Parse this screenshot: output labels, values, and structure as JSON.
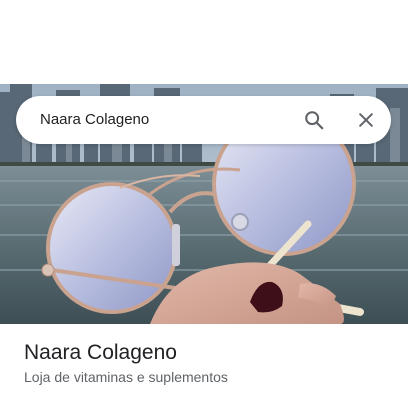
{
  "search": {
    "query": "Naara Colageno",
    "search_icon": "search-icon",
    "close_icon": "close-icon"
  },
  "place": {
    "name": "Naara Colageno",
    "category": "Loja de vitaminas e suplementos"
  },
  "colors": {
    "text_primary": "#202124",
    "text_secondary": "#5f6368",
    "icon": "#5f6368"
  }
}
